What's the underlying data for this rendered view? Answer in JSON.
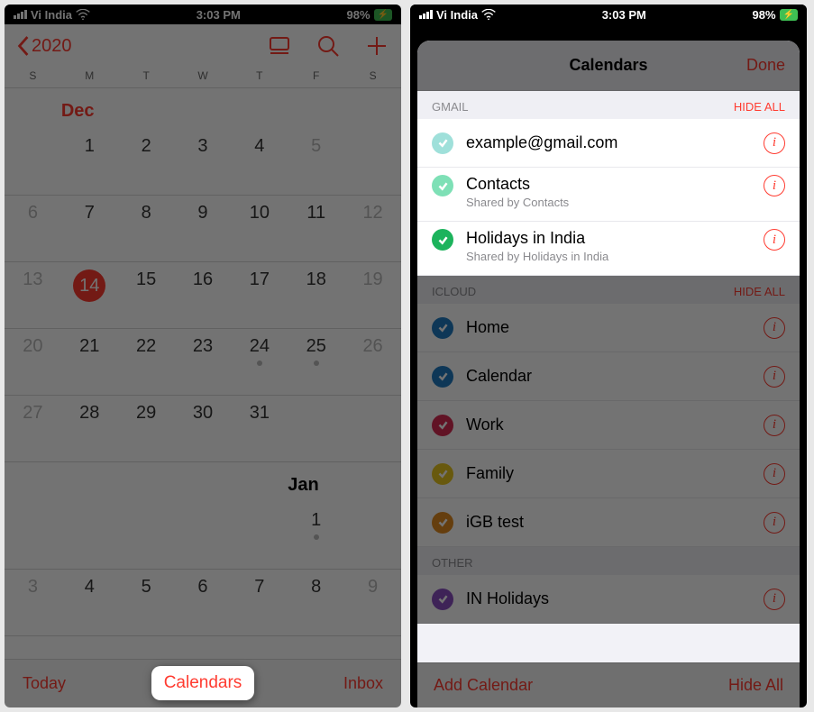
{
  "status": {
    "carrier": "Vi India",
    "time": "3:03 PM",
    "battery": "98%"
  },
  "left": {
    "back_year": "2020",
    "weekdays": [
      "S",
      "M",
      "T",
      "W",
      "T",
      "F",
      "S"
    ],
    "month1_label": "Dec",
    "month1_rows": [
      [
        {
          "n": "",
          "t": "label"
        },
        {
          "n": "1"
        },
        {
          "n": "2"
        },
        {
          "n": "3"
        },
        {
          "n": "4"
        },
        {
          "n": "5",
          "o": true
        },
        {
          "n": ""
        }
      ],
      [
        {
          "n": "6",
          "o": true
        },
        {
          "n": "7"
        },
        {
          "n": "8"
        },
        {
          "n": "9"
        },
        {
          "n": "10"
        },
        {
          "n": "11"
        },
        {
          "n": "12",
          "o": true
        }
      ],
      [
        {
          "n": "13",
          "o": true
        },
        {
          "n": "14",
          "today": true
        },
        {
          "n": "15"
        },
        {
          "n": "16"
        },
        {
          "n": "17"
        },
        {
          "n": "18"
        },
        {
          "n": "19",
          "o": true
        }
      ],
      [
        {
          "n": "20",
          "o": true
        },
        {
          "n": "21"
        },
        {
          "n": "22"
        },
        {
          "n": "23"
        },
        {
          "n": "24",
          "dot": true
        },
        {
          "n": "25",
          "dot": true
        },
        {
          "n": "26",
          "o": true
        }
      ],
      [
        {
          "n": "27",
          "o": true
        },
        {
          "n": "28"
        },
        {
          "n": "29"
        },
        {
          "n": "30"
        },
        {
          "n": "31"
        },
        {
          "n": ""
        },
        {
          "n": ""
        }
      ]
    ],
    "month2_label": "Jan",
    "month2_rows": [
      [
        {
          "n": ""
        },
        {
          "n": ""
        },
        {
          "n": ""
        },
        {
          "n": ""
        },
        {
          "n": ""
        },
        {
          "n": "1",
          "dot": true
        },
        {
          "n": ""
        }
      ],
      [
        {
          "n": "3",
          "o": true
        },
        {
          "n": "4"
        },
        {
          "n": "5"
        },
        {
          "n": "6"
        },
        {
          "n": "7"
        },
        {
          "n": "8"
        },
        {
          "n": "9",
          "o": true
        }
      ]
    ],
    "today_label": "Today",
    "calendars_label": "Calendars",
    "inbox_label": "Inbox"
  },
  "right": {
    "title": "Calendars",
    "done": "Done",
    "sections": [
      {
        "name": "GMAIL",
        "hide": "HIDE ALL",
        "active": true,
        "items": [
          {
            "title": "example@gmail.com",
            "color": "#9fe0da"
          },
          {
            "title": "Contacts",
            "sub": "Shared by Contacts",
            "color": "#7ee0b6"
          },
          {
            "title": "Holidays in India",
            "sub": "Shared by Holidays in India",
            "color": "#1cb35c"
          }
        ]
      },
      {
        "name": "ICLOUD",
        "hide": "HIDE ALL",
        "active": false,
        "items": [
          {
            "title": "Home",
            "color": "#1f7bc2"
          },
          {
            "title": "Calendar",
            "color": "#1f7bc2"
          },
          {
            "title": "Work",
            "color": "#d72a53"
          },
          {
            "title": "Family",
            "color": "#e7c51f"
          },
          {
            "title": "iGB test",
            "color": "#e08a1f"
          }
        ]
      },
      {
        "name": "OTHER",
        "hide": "",
        "active": false,
        "items": [
          {
            "title": "IN Holidays",
            "color": "#8a4fc2"
          }
        ]
      }
    ],
    "add_label": "Add Calendar",
    "hideall_label": "Hide All"
  }
}
